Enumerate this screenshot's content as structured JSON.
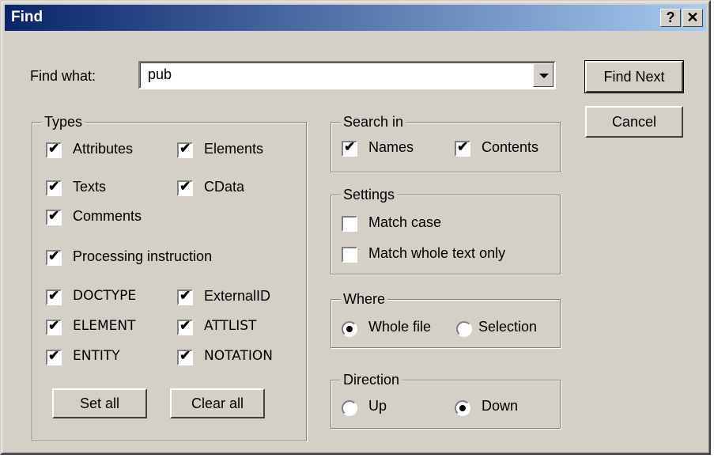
{
  "window": {
    "title": "Find",
    "help_glyph": "?",
    "close_glyph": "✕"
  },
  "find": {
    "label": "Find what:",
    "value": "pub"
  },
  "buttons": {
    "find_next": "Find Next",
    "cancel": "Cancel",
    "set_all": "Set all",
    "clear_all": "Clear all"
  },
  "types": {
    "legend": "Types",
    "items": [
      {
        "label": "Attributes",
        "checked": true
      },
      {
        "label": "Elements",
        "checked": true
      },
      {
        "label": "Texts",
        "checked": true
      },
      {
        "label": "CData",
        "checked": true
      },
      {
        "label": "Comments",
        "checked": true
      },
      {
        "label": "Processing instruction",
        "checked": true
      },
      {
        "label": "DOCTYPE",
        "checked": true
      },
      {
        "label": "ExternalID",
        "checked": true
      },
      {
        "label": "ELEMENT",
        "checked": true
      },
      {
        "label": "ATTLIST",
        "checked": true
      },
      {
        "label": "ENTITY",
        "checked": true
      },
      {
        "label": "NOTATION",
        "checked": true
      }
    ]
  },
  "search_in": {
    "legend": "Search in",
    "names": "Names",
    "names_checked": true,
    "contents": "Contents",
    "contents_checked": true
  },
  "settings": {
    "legend": "Settings",
    "match_case": "Match case",
    "match_case_checked": false,
    "match_whole": "Match whole text only",
    "match_whole_checked": false
  },
  "where": {
    "legend": "Where",
    "whole_file": "Whole file",
    "selection": "Selection",
    "selected": "whole_file"
  },
  "direction": {
    "legend": "Direction",
    "up": "Up",
    "down": "Down",
    "selected": "down"
  },
  "glyphs": {
    "check": "✔"
  }
}
